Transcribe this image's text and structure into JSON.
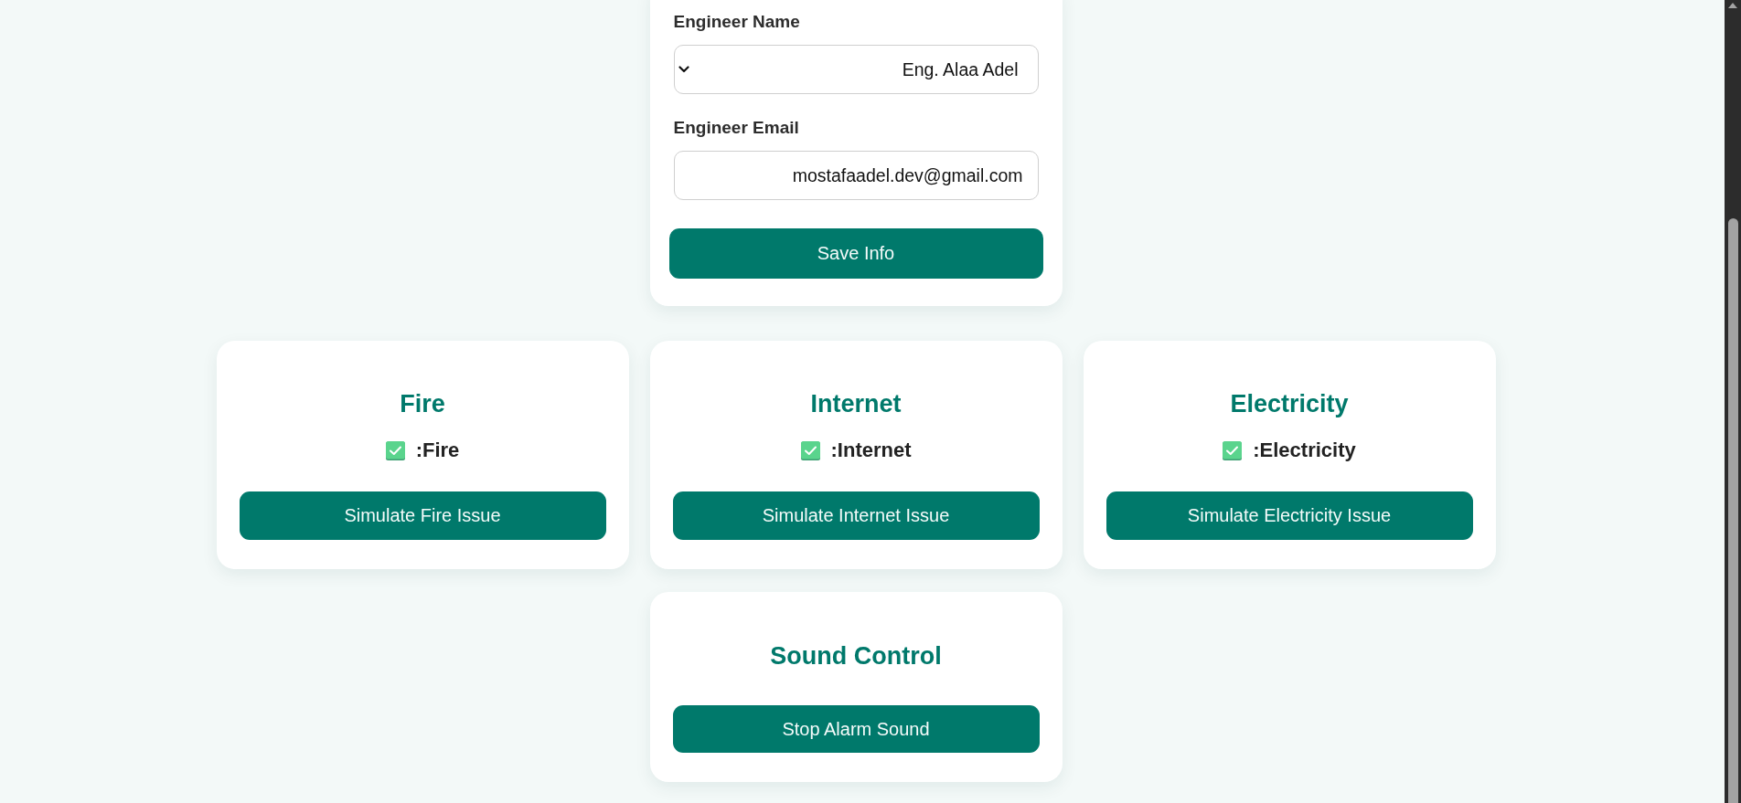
{
  "engineer_form": {
    "fields": [
      {
        "kind": "select",
        "label": "Engineer Name",
        "value": "Eng. Alaa Adel"
      },
      {
        "kind": "input",
        "label": "Engineer Email",
        "value": "mostafaadel.dev@gmail.com"
      }
    ],
    "button": "Save Info"
  },
  "issue_cards": [
    {
      "title": "Fire",
      "status": {
        "checked": true,
        "text": ":Fire"
      },
      "button": "Simulate Fire Issue"
    },
    {
      "title": "Internet",
      "status": {
        "checked": true,
        "text": ":Internet"
      },
      "button": "Simulate Internet Issue"
    },
    {
      "title": "Electricity",
      "status": {
        "checked": true,
        "text": ":Electricity"
      },
      "button": "Simulate Electricity Issue"
    }
  ],
  "sound_control": {
    "title": "Sound Control",
    "button": "Stop Alarm Sound"
  }
}
